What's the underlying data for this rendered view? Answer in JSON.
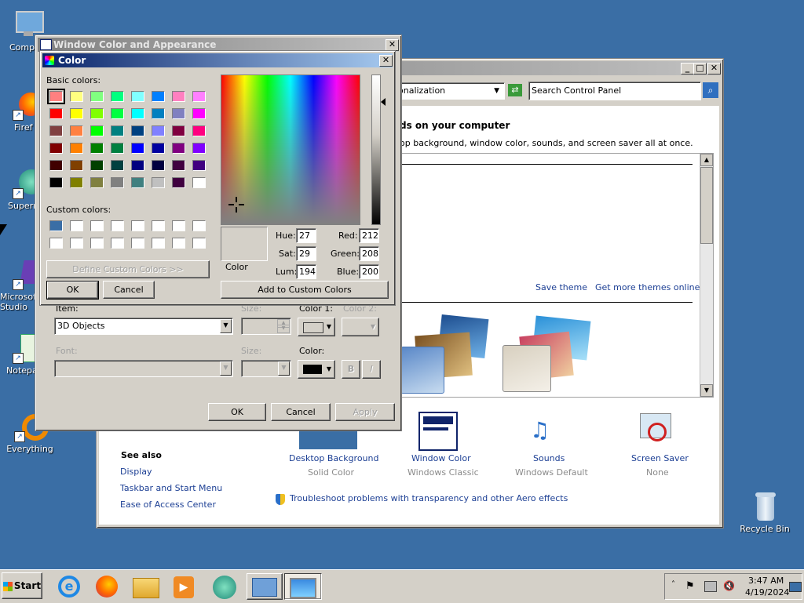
{
  "desktop": {
    "icons": [
      {
        "label": "Compu"
      },
      {
        "label": "Firef"
      },
      {
        "label": "Superm"
      },
      {
        "label": "Microsof\nStudio"
      },
      {
        "label": "Notepa"
      },
      {
        "label": "Everything"
      },
      {
        "label": "Recycle Bin"
      }
    ]
  },
  "control_panel": {
    "address": "onalization",
    "search_placeholder": "Search Control Panel",
    "heading": "ds on your computer",
    "subheading": "op background, window color, sounds, and screen saver all at once.",
    "save_theme": "Save theme",
    "get_more_themes": "Get more themes online",
    "see_also_title": "See also",
    "see_also": [
      "Display",
      "Taskbar and Start Menu",
      "Ease of Access Center"
    ],
    "bottom_items": [
      {
        "label": "Desktop Background",
        "value": "Solid Color",
        "icon": "desktop-background-icon"
      },
      {
        "label": "Window Color",
        "value": "Windows Classic",
        "icon": "window-color-icon"
      },
      {
        "label": "Sounds",
        "value": "Windows Default",
        "icon": "sounds-icon"
      },
      {
        "label": "Screen Saver",
        "value": "None",
        "icon": "screen-saver-icon"
      }
    ],
    "troubleshoot": "Troubleshoot problems with transparency and other Aero effects"
  },
  "appearance_dialog": {
    "title": "Window Color and Appearance",
    "item_label": "Item:",
    "item_value": "3D Objects",
    "size_label": "Size:",
    "color1_label": "Color 1:",
    "color2_label": "Color 2:",
    "font_label": "Font:",
    "size2_label": "Size:",
    "color_label": "Color:",
    "bold": "B",
    "italic": "I",
    "ok": "OK",
    "cancel": "Cancel",
    "apply": "Apply"
  },
  "color_dialog": {
    "title": "Color",
    "basic_colors_label": "Basic colors:",
    "custom_colors_label": "Custom colors:",
    "define_custom": "Define Custom Colors >>",
    "ok": "OK",
    "cancel": "Cancel",
    "add_custom": "Add to Custom Colors",
    "color_solid_label": "Color",
    "hue_label": "Hue:",
    "hue": "27",
    "sat_label": "Sat:",
    "sat": "29",
    "lum_label": "Lum:",
    "lum": "194",
    "red_label": "Red:",
    "red": "212",
    "green_label": "Green:",
    "green": "208",
    "blue_label": "Blue:",
    "blue": "200",
    "current_color": "#d4d0c8",
    "basic_colors": [
      "#ff8080",
      "#ffff80",
      "#80ff80",
      "#00ff80",
      "#80ffff",
      "#0080ff",
      "#ff80c0",
      "#ff80ff",
      "#ff0000",
      "#ffff00",
      "#80ff00",
      "#00ff40",
      "#00ffff",
      "#0080c0",
      "#8080c0",
      "#ff00ff",
      "#804040",
      "#ff8040",
      "#00ff00",
      "#008080",
      "#004080",
      "#8080ff",
      "#800040",
      "#ff0080",
      "#800000",
      "#ff8000",
      "#008000",
      "#008040",
      "#0000ff",
      "#0000a0",
      "#800080",
      "#8000ff",
      "#400000",
      "#804000",
      "#004000",
      "#004040",
      "#000080",
      "#000040",
      "#400040",
      "#400080",
      "#000000",
      "#808000",
      "#808040",
      "#808080",
      "#408080",
      "#c0c0c0",
      "#400040",
      "#ffffff"
    ],
    "custom_colors": [
      "#3a6ea5",
      "#ffffff",
      "#ffffff",
      "#ffffff",
      "#ffffff",
      "#ffffff",
      "#ffffff",
      "#ffffff",
      "#ffffff",
      "#ffffff",
      "#ffffff",
      "#ffffff",
      "#ffffff",
      "#ffffff",
      "#ffffff",
      "#ffffff"
    ]
  },
  "taskbar": {
    "start": "Start",
    "time": "3:47 AM",
    "date": "4/19/2024"
  }
}
